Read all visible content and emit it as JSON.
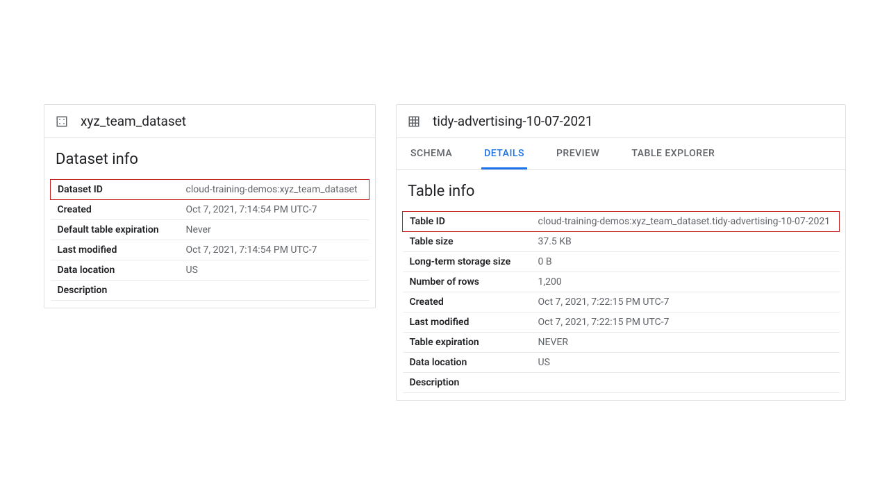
{
  "dataset_panel": {
    "title": "xyz_team_dataset",
    "section_title": "Dataset info",
    "rows": {
      "dataset_id": {
        "label": "Dataset ID",
        "value": "cloud-training-demos:xyz_team_dataset"
      },
      "created": {
        "label": "Created",
        "value": "Oct 7, 2021, 7:14:54 PM UTC-7"
      },
      "default_expiration": {
        "label": "Default table expiration",
        "value": "Never"
      },
      "last_modified": {
        "label": "Last modified",
        "value": "Oct 7, 2021, 7:14:54 PM UTC-7"
      },
      "data_location": {
        "label": "Data location",
        "value": "US"
      },
      "description": {
        "label": "Description",
        "value": ""
      }
    }
  },
  "table_panel": {
    "title": "tidy-advertising-10-07-2021",
    "tabs": {
      "schema": "SCHEMA",
      "details": "DETAILS",
      "preview": "PREVIEW",
      "explorer": "TABLE EXPLORER"
    },
    "section_title": "Table info",
    "rows": {
      "table_id": {
        "label": "Table ID",
        "value": "cloud-training-demos:xyz_team_dataset.tidy-advertising-10-07-2021"
      },
      "table_size": {
        "label": "Table size",
        "value": "37.5 KB"
      },
      "lt_storage": {
        "label": "Long-term storage size",
        "value": "0 B"
      },
      "num_rows": {
        "label": "Number of rows",
        "value": "1,200"
      },
      "created": {
        "label": "Created",
        "value": "Oct 7, 2021, 7:22:15 PM UTC-7"
      },
      "last_modified": {
        "label": "Last modified",
        "value": "Oct 7, 2021, 7:22:15 PM UTC-7"
      },
      "expiration": {
        "label": "Table expiration",
        "value": "NEVER"
      },
      "data_location": {
        "label": "Data location",
        "value": "US"
      },
      "description": {
        "label": "Description",
        "value": ""
      }
    }
  }
}
